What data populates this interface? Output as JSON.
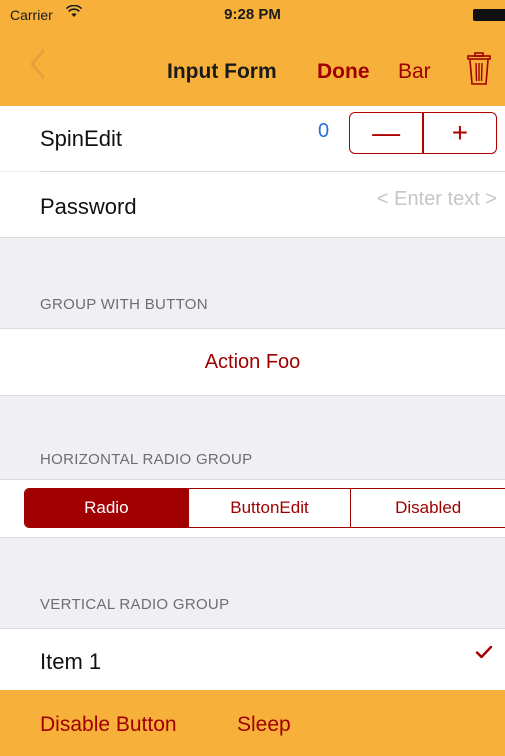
{
  "status_bar": {
    "carrier": "Carrier",
    "time": "9:28 PM"
  },
  "nav": {
    "back_icon": "chevron-left-icon",
    "title": "Input Form",
    "done_label": "Done",
    "bar_label": "Bar",
    "trash_icon": "trash-icon"
  },
  "form": {
    "spinedit_label": "SpinEdit",
    "spinedit_value": "0",
    "minus_symbol": "—",
    "plus_symbol": "+",
    "password_label": "Password",
    "password_placeholder": "< Enter text >"
  },
  "group_with_button": {
    "header": "GROUP WITH BUTTON",
    "action_label": "Action Foo"
  },
  "horizontal_radio": {
    "header": "HORIZONTAL RADIO GROUP",
    "options": [
      "Radio",
      "ButtonEdit",
      "Disabled"
    ],
    "selected": "Radio"
  },
  "vertical_radio": {
    "header": "VERTICAL RADIO GROUP",
    "item1": "Item 1",
    "item1_checked": true
  },
  "toolbar": {
    "disable_label": "Disable Button",
    "sleep_label": "Sleep"
  },
  "colors": {
    "accent": "#a00000",
    "bar_bg": "#f7b13a",
    "background": "#efeff4"
  }
}
